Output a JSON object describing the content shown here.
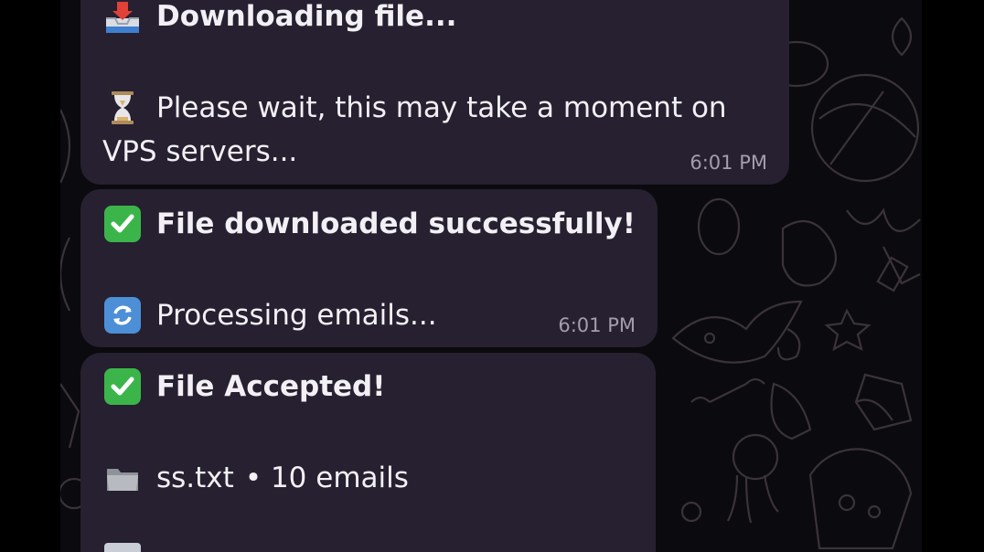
{
  "messages": [
    {
      "lines": [
        {
          "icon": "inbox-tray-icon",
          "text": "Downloading file...",
          "bold": true
        },
        {
          "icon": "hourglass-icon",
          "text": "Please wait, this may take a moment on",
          "bold": false
        },
        {
          "icon": "",
          "text": "VPS servers...",
          "bold": false
        }
      ],
      "time": "6:01 PM"
    },
    {
      "lines": [
        {
          "icon": "check-mark-icon",
          "text": "File downloaded successfully!",
          "bold": true
        },
        {
          "icon": "refresh-icon",
          "text": "Processing emails...",
          "bold": false
        }
      ],
      "time": "6:01 PM"
    },
    {
      "lines": [
        {
          "icon": "check-mark-icon",
          "text": "File Accepted!",
          "bold": true
        },
        {
          "icon": "folder-icon",
          "text": "ss.txt",
          "bold": false
        },
        {
          "icon": "",
          "text": "• 10 emails",
          "bold": false
        }
      ],
      "time": ""
    }
  ],
  "colors": {
    "bubble": "#262030",
    "background": "#0b0a0e",
    "text": "#f2f0f5",
    "timestamp": "#a39eae",
    "check_green": "#3bb54a",
    "refresh_blue": "#4d8fd6"
  }
}
